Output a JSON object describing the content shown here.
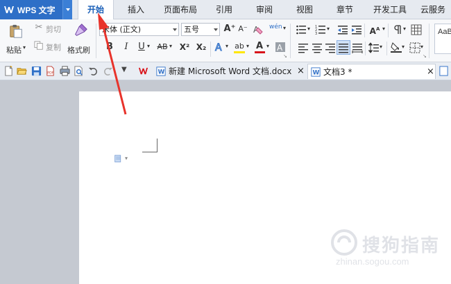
{
  "app": {
    "title": "WPS 文字"
  },
  "tabs": [
    {
      "label": "开始",
      "active": true
    },
    {
      "label": "插入"
    },
    {
      "label": "页面布局"
    },
    {
      "label": "引用"
    },
    {
      "label": "审阅"
    },
    {
      "label": "视图"
    },
    {
      "label": "章节"
    },
    {
      "label": "开发工具"
    },
    {
      "label": "云服务"
    }
  ],
  "ribbon": {
    "paste": "粘贴",
    "cut": "剪切",
    "copy": "复制",
    "format_painter": "格式刷",
    "font_name": "宋体 (正文)",
    "font_size": "五号",
    "bold": "B",
    "italic": "I",
    "underline": "U",
    "strikethrough": "AB",
    "superscript": "X²",
    "subscript": "X₂",
    "grow_font": "A⁺",
    "shrink_font": "A⁻",
    "phonetic": "wén",
    "font_color_letter": "A",
    "highlight_letter": "ab",
    "style_preview": "AaB"
  },
  "quick_access": {
    "doc_tabs": [
      {
        "label": "新建 Microsoft Word 文档.docx",
        "active": false
      },
      {
        "label": "文档3 *",
        "active": true
      }
    ],
    "close_glyph": "×"
  },
  "watermark": {
    "brand": "搜狗指南",
    "url": "zhinan.sogou.com"
  },
  "colors": {
    "accent": "#2e6fc7",
    "annotation_arrow": "#e8332b",
    "highlight_yellow": "#ffe600",
    "font_red": "#d8141b"
  }
}
